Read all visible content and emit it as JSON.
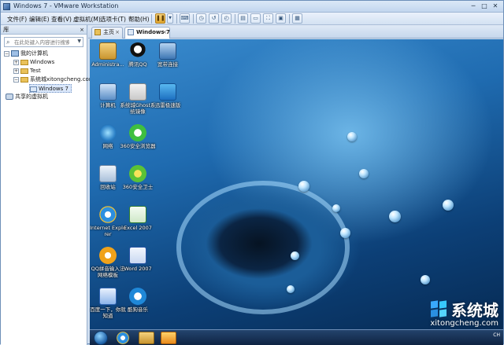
{
  "window": {
    "title": "Windows 7 - VMware Workstation"
  },
  "menu": {
    "file": "文件(F)",
    "edit": "编辑(E)",
    "view": "查看(V)",
    "vm": "虚拟机(M)",
    "tabs": "选项卡(T)",
    "help": "帮助(H)"
  },
  "sidebar": {
    "title": "库",
    "close": "×",
    "search_placeholder": "在此处键入内容进行搜索",
    "tree": {
      "root": "我的计算机",
      "items": [
        "Windows",
        "Test",
        "系统城xitongcheng.com",
        "Windows 7"
      ],
      "shared": "共享的虚拟机"
    }
  },
  "tabs": [
    {
      "label": "主页",
      "close": "×"
    },
    {
      "label": "Windows 7",
      "close": "×"
    }
  ],
  "desktop": {
    "icons": [
      "Administra...",
      "腾讯QQ",
      "宽带连接",
      "计算机",
      "系统城Ghost系统镜像",
      "迅雷极速版",
      "网络",
      "360安全浏览器",
      "回收站",
      "360安全卫士",
      "Internet Explorer",
      "Excel 2007",
      "QQ拼音输入法 网络模板",
      "Word 2007",
      "百度一下，你就知道",
      "酷狗音乐"
    ]
  },
  "taskbar": {
    "tray_text": "CH"
  },
  "watermark": {
    "cn": "系统城",
    "en": "xitongcheng.com"
  }
}
